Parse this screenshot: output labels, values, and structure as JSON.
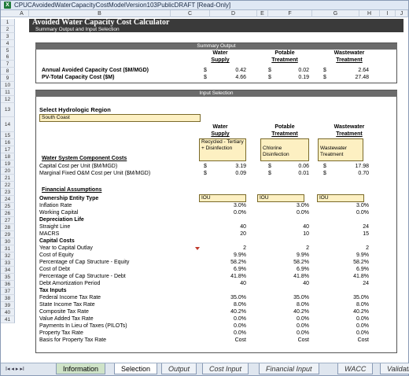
{
  "window": {
    "title": "CPUCAvoidedWaterCapacityCostModelVersion103PublicDRAFT  [Read-Only]"
  },
  "columns": [
    "A",
    "B",
    "C",
    "D",
    "E",
    "F",
    "G",
    "H",
    "I",
    "J"
  ],
  "sheet": {
    "title": "Avoided Water Capacity Cost Calculator",
    "subtitle": "Summary Output and Input Selection",
    "summary_header": "Summary Output",
    "col_heads": [
      {
        "line1": "Water",
        "line2": "Supply"
      },
      {
        "line1": "Potable",
        "line2": "Treatment"
      },
      {
        "line1": "Wastewater",
        "line2": "Treatment"
      }
    ],
    "summary_rows": [
      {
        "label": "Annual Avoided Capacity Cost ($M/MGD)",
        "sym": "$",
        "v1": "0.42",
        "v2": "0.02",
        "v3": "2.64"
      },
      {
        "label": "PV-Total Capacity Cost ($M)",
        "sym": "$",
        "v1": "4.66",
        "v2": "0.19",
        "v3": "27.48"
      }
    ],
    "input_header": "Input Selection",
    "region_label": "Select Hydrologic Region",
    "region_value": "South Coast",
    "components_label": "Water System Component Costs",
    "components": [
      "Recycled - Tertiary + Disinfection",
      "Chlorine Disinfection",
      "Wastewater Treatment"
    ],
    "cost_rows": [
      {
        "label": "Capital Cost per Unit ($M/MGD)",
        "sym": "$",
        "v1": "3.19",
        "v2": "0.06",
        "v3": "17.98"
      },
      {
        "label": "Marginal Fixed O&M Cost per Unit ($M/MGD)",
        "sym": "$",
        "v1": "0.09",
        "v2": "0.01",
        "v3": "0.70"
      }
    ],
    "fin_label": "Financial Assumptions",
    "ownership_label": "Ownership Entity Type",
    "ownership": [
      "IOU",
      "IOU",
      "IOU"
    ],
    "rows": [
      {
        "label": "Inflation Rate",
        "v": [
          "3.0%",
          "3.0%",
          "3.0%"
        ]
      },
      {
        "label": "Working Capital",
        "v": [
          "0.0%",
          "0.0%",
          "0.0%"
        ]
      },
      {
        "label": "Depreciation Life",
        "bold": true,
        "v": [
          "",
          "",
          ""
        ]
      },
      {
        "label": "Straight Line",
        "v": [
          "40",
          "40",
          "24"
        ]
      },
      {
        "label": "MACRS",
        "v": [
          "20",
          "10",
          "15"
        ]
      },
      {
        "label": "Capital Costs",
        "bold": true,
        "v": [
          "",
          "",
          ""
        ]
      },
      {
        "label": "Year to Capital Outlay",
        "v": [
          "2",
          "2",
          "2"
        ]
      },
      {
        "label": "Cost of Equity",
        "v": [
          "9.9%",
          "9.9%",
          "9.9%"
        ]
      },
      {
        "label": "Percentage of Cap Structure - Equity",
        "v": [
          "58.2%",
          "58.2%",
          "58.2%"
        ]
      },
      {
        "label": "Cost of Debt",
        "v": [
          "6.9%",
          "6.9%",
          "6.9%"
        ]
      },
      {
        "label": "Percentage of Cap Structure - Debt",
        "v": [
          "41.8%",
          "41.8%",
          "41.8%"
        ]
      },
      {
        "label": "Debt Amortization Period",
        "v": [
          "40",
          "40",
          "24"
        ]
      },
      {
        "label": "Tax Inputs",
        "bold": true,
        "v": [
          "",
          "",
          ""
        ]
      },
      {
        "label": "Federal Income Tax Rate",
        "v": [
          "35.0%",
          "35.0%",
          "35.0%"
        ]
      },
      {
        "label": "State Income Tax Rate",
        "v": [
          "8.0%",
          "8.0%",
          "8.0%"
        ]
      },
      {
        "label": "Composite Tax Rate",
        "v": [
          "40.2%",
          "40.2%",
          "40.2%"
        ]
      },
      {
        "label": "Value Added Tax Rate",
        "v": [
          "0.0%",
          "0.0%",
          "0.0%"
        ]
      },
      {
        "label": "Payments In Lieu of Taxes (PILOTs)",
        "v": [
          "0.0%",
          "0.0%",
          "0.0%"
        ]
      },
      {
        "label": "Property Tax Rate",
        "v": [
          "0.0%",
          "0.0%",
          "0.0%"
        ]
      },
      {
        "label": "Basis for Property Tax Rate",
        "v": [
          "Cost",
          "Cost",
          "Cost"
        ]
      }
    ]
  },
  "row_numbers": [
    "1",
    "2",
    "3",
    "4",
    "5",
    "6",
    "7",
    "8",
    "9",
    "10",
    "11",
    "12",
    "13",
    "14",
    "15",
    "16",
    "17",
    "18",
    "19",
    "20",
    "21",
    "22",
    "23",
    "24",
    "25",
    "26",
    "27",
    "28",
    "29",
    "30",
    "31",
    "32",
    "33",
    "34",
    "35",
    "36",
    "37",
    "38",
    "39",
    "40",
    "41"
  ],
  "tabs": {
    "nav": "I◂ ◂ ▸ ▸I",
    "items": [
      "Information",
      "Selection",
      "Output",
      "Cost  Input",
      "Financial  Input",
      "WACC",
      "Validati"
    ]
  }
}
